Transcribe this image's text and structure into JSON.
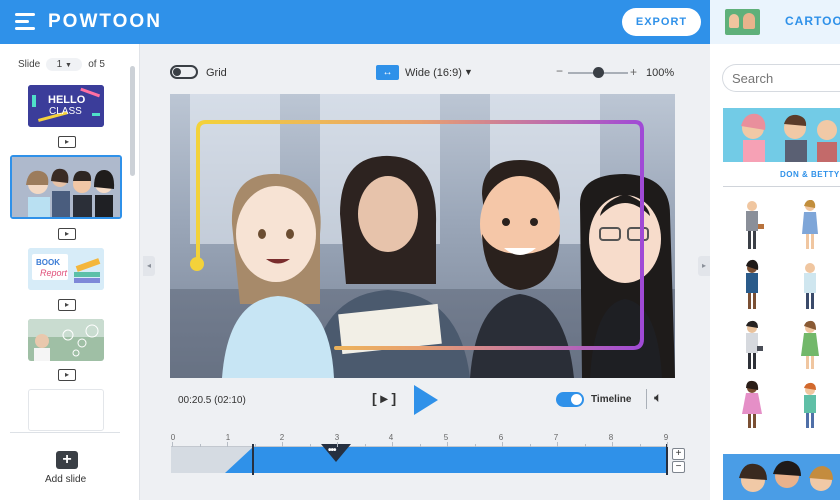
{
  "app": {
    "logo": "POWTOON",
    "export_label": "EXPORT",
    "brand_color": "#2f91e9"
  },
  "library": {
    "title": "CARTOON",
    "search_placeholder": "Search",
    "banner_title": "DON & BETTY"
  },
  "slides": {
    "label": "Slide",
    "current": "1",
    "of_label": "of 5",
    "thumbnails": [
      {
        "text_1": "HELLO",
        "text_2": "CLASS"
      },
      {
        "text_1": "",
        "text_2": ""
      },
      {
        "text_1": "BOOK",
        "text_2": "Report"
      },
      {
        "text_1": "",
        "text_2": ""
      },
      {
        "text_1": "",
        "text_2": ""
      }
    ],
    "add_slide_label": "Add slide"
  },
  "toolbar": {
    "grid_label": "Grid",
    "grid_on": false,
    "aspect_label": "Wide (16:9)",
    "zoom_value": "100%",
    "zoom_level": 0.5
  },
  "playback": {
    "time": "00:20.5 (02:10)",
    "timeline_label": "Timeline",
    "timeline_on": true
  },
  "timeline": {
    "ticks": [
      "0",
      "1",
      "2",
      "3",
      "4",
      "5",
      "6",
      "7",
      "8",
      "9"
    ],
    "playhead_label": "•••",
    "zoom_in": "+",
    "zoom_out": "−"
  }
}
